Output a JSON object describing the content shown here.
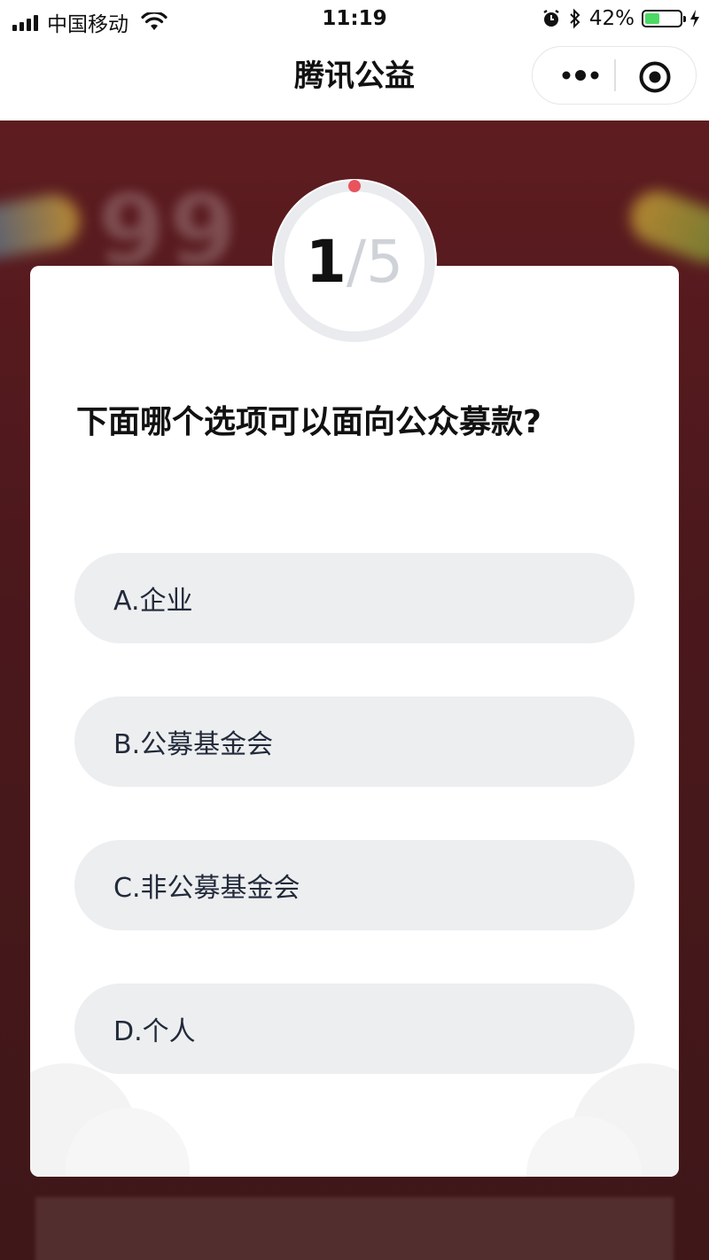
{
  "status_bar": {
    "carrier": "中国移动",
    "time": "11:19",
    "battery_percent": "42%",
    "battery_level": 0.42
  },
  "nav": {
    "title": "腾讯公益"
  },
  "quiz": {
    "progress": {
      "current": "1",
      "separator": "/",
      "total": "5",
      "fraction": 0.0
    },
    "question": "下面哪个选项可以面向公众募款?",
    "options": [
      {
        "label": "A.企业"
      },
      {
        "label": "B.公募基金会"
      },
      {
        "label": "C.非公募基金会"
      },
      {
        "label": "D.个人"
      }
    ]
  },
  "colors": {
    "accent": "#e8535d",
    "option_bg": "#edeef0",
    "background": "#4a1b1f"
  }
}
